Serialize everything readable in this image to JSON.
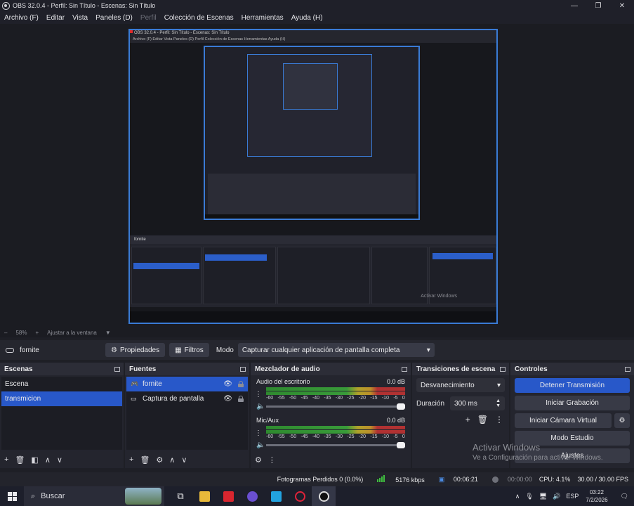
{
  "window": {
    "title": "OBS 32.0.4 - Perfil: Sin Título - Escenas: Sin Título",
    "minimize": "—",
    "maximize": "❐",
    "close": "✕"
  },
  "menu": [
    "Archivo (F)",
    "Editar",
    "Vista",
    "Paneles (D)",
    "Perfil",
    "Colección de Escenas",
    "Herramientas",
    "Ayuda (H)"
  ],
  "preview": {
    "mini_title": "OBS 32.0.4 - Perfil: Sin Título - Escenas: Sin Título",
    "mini_menu": "Archivo (F)   Editar   Vista   Paneles (D)   Perfil   Colección de Escenas   Herramientas   Ayuda (H)",
    "mini_watermark": "Activar Windows"
  },
  "zoom": {
    "level": "58%",
    "fit": "Ajustar a la ventana"
  },
  "source_toolbar": {
    "current_source": "fornite",
    "properties": "Propiedades",
    "filters": "Filtros",
    "mode_label": "Modo",
    "mode_value": "Capturar cualquier aplicación de pantalla completa"
  },
  "scenes": {
    "title": "Escenas",
    "items": [
      {
        "label": "Escena",
        "selected": false
      },
      {
        "label": "transmicion",
        "selected": true
      }
    ]
  },
  "sources": {
    "title": "Fuentes",
    "items": [
      {
        "label": "fornite",
        "icon": "gamepad-icon",
        "selected": true
      },
      {
        "label": "Captura de pantalla",
        "icon": "monitor-icon",
        "selected": false
      }
    ]
  },
  "mixer": {
    "title": "Mezclador de audio",
    "ticks": [
      "-60",
      "-55",
      "-50",
      "-45",
      "-40",
      "-35",
      "-30",
      "-25",
      "-20",
      "-15",
      "-10",
      "-5",
      "0"
    ],
    "channels": [
      {
        "name": "Audio del escritorio",
        "db": "0.0 dB"
      },
      {
        "name": "Mic/Aux",
        "db": "0.0 dB"
      }
    ]
  },
  "transitions": {
    "title": "Transiciones de escena",
    "selected": "Desvanecimiento",
    "duration_label": "Duración",
    "duration_value": "300 ms"
  },
  "controls": {
    "title": "Controles",
    "stop_stream": "Detener Transmisión",
    "start_recording": "Iniciar Grabación",
    "start_virtual_cam": "Iniciar Cámara Virtual",
    "studio_mode": "Modo Estudio",
    "settings": "Ajustes"
  },
  "watermark": {
    "line1": "Activar Windows",
    "line2": "Ve a Configuración para activar Windows."
  },
  "status": {
    "dropped_frames": "Fotogramas Perdidos 0 (0.0%)",
    "bitrate": "5176 kbps",
    "stream_time": "00:06:21",
    "record_time": "00:00:00",
    "cpu": "CPU: 4.1%",
    "fps": "30.00 / 30.00 FPS"
  },
  "taskbar": {
    "search": "Buscar",
    "language": "ESP",
    "time": "03:22",
    "date": "7/2/2026"
  },
  "colors": {
    "accent": "#2858c9",
    "preview_border": "#3a7bd5",
    "background": "#1e1f26"
  }
}
